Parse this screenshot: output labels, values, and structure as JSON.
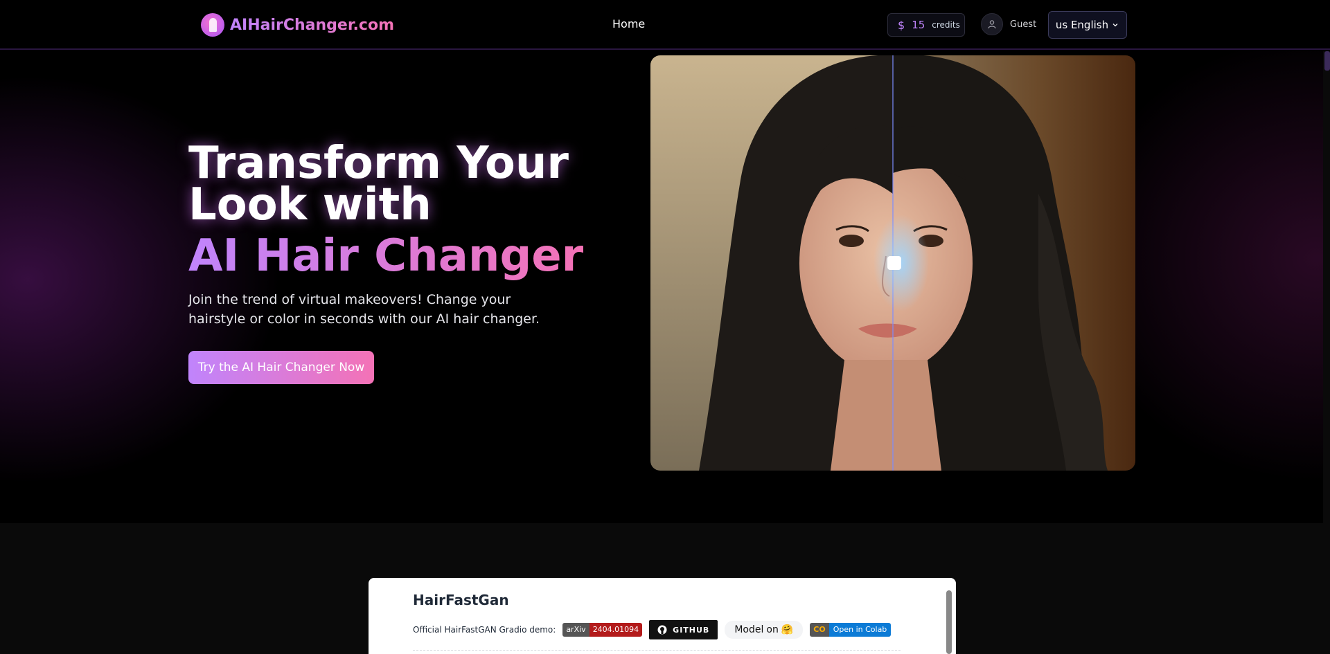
{
  "header": {
    "logo_text": "AIHairChanger.com",
    "nav_home": "Home",
    "credits_symbol": "$",
    "credits_value": "15",
    "credits_label": "credits",
    "guest_label": "Guest",
    "language_label": "us English"
  },
  "hero": {
    "title_line1": "Transform Your Look with",
    "title_line2": "AI Hair Changer",
    "subtitle": "Join the trend of virtual makeovers! Change your hairstyle or color in seconds with our AI hair changer.",
    "cta_label": "Try the AI Hair Changer Now",
    "compare_split": 0.5
  },
  "demo": {
    "title": "HairFastGan",
    "description": "Official HairFastGAN Gradio demo:",
    "arxiv_left": "arXiv",
    "arxiv_right": "2404.01094",
    "github_label": "GITHUB",
    "model_label": "Model",
    "model_on": "on",
    "model_emoji": "🤗",
    "colab_icon": "CO",
    "colab_label": "Open in Colab"
  },
  "colors": {
    "accent_purple": "#c084fc",
    "accent_pink": "#f472b6"
  }
}
